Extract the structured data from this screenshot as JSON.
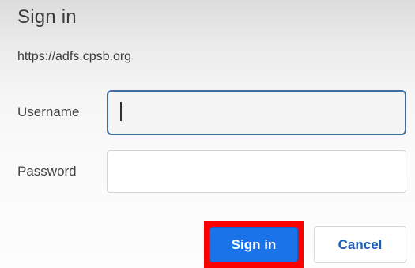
{
  "dialog": {
    "title": "Sign in",
    "origin": "https://adfs.cpsb.org"
  },
  "form": {
    "username_label": "Username",
    "username_value": "",
    "password_label": "Password",
    "password_value": ""
  },
  "buttons": {
    "sign_in_label": "Sign in",
    "cancel_label": "Cancel"
  },
  "colors": {
    "primary_button": "#1a73e8",
    "highlight_box": "#ff0000",
    "focused_border": "#3c6d9e",
    "cancel_text": "#1a5fb4"
  }
}
